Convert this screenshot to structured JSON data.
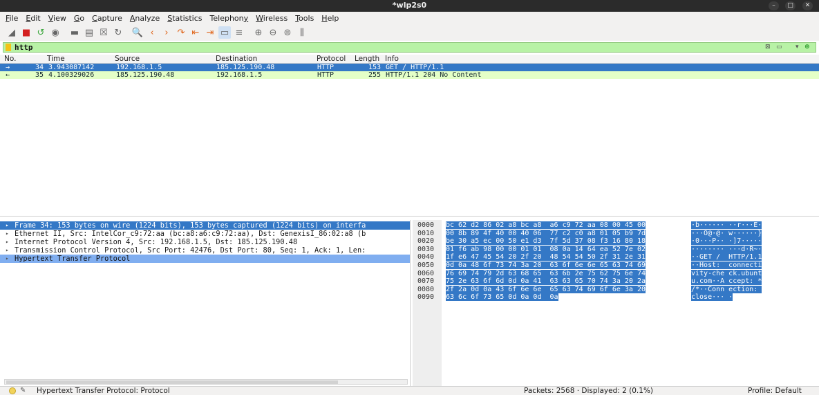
{
  "window": {
    "title": "*wlp2s0",
    "controls": [
      "–",
      "□",
      "✕"
    ]
  },
  "menubar": [
    {
      "key": "F",
      "rest": "ile"
    },
    {
      "key": "E",
      "rest": "dit"
    },
    {
      "key": "V",
      "rest": "iew"
    },
    {
      "key": "G",
      "rest": "o"
    },
    {
      "key": "C",
      "rest": "apture"
    },
    {
      "key": "A",
      "rest": "nalyze"
    },
    {
      "key": "S",
      "rest": "tatistics"
    },
    {
      "pre": "Telephon",
      "key": "y",
      "rest": ""
    },
    {
      "key": "W",
      "rest": "ireless"
    },
    {
      "key": "T",
      "rest": "ools"
    },
    {
      "key": "H",
      "rest": "elp"
    }
  ],
  "toolbar": {
    "icons": [
      "shark-fin-icon",
      "stop-icon",
      "restart-icon",
      "options-icon",
      "open-icon",
      "save-icon",
      "close-file-icon",
      "reload-icon",
      "find-icon",
      "go-back-icon",
      "go-forward-icon",
      "go-to-packet-icon",
      "first-packet-icon",
      "last-packet-icon",
      "autoscroll-icon",
      "colorize-icon",
      "zoom-in-icon",
      "zoom-out-icon",
      "normal-size-icon",
      "resize-columns-icon"
    ],
    "glyphs": [
      "◢",
      "■",
      "↺",
      "◉",
      "▬",
      "▤",
      "☒",
      "↻",
      "🔍",
      "‹",
      "›",
      "↷",
      "⇤",
      "⇥",
      "▭",
      "≡",
      "⊕",
      "⊖",
      "⊜",
      "⫼"
    ]
  },
  "filter": {
    "value": "http",
    "controls": [
      "⊠",
      "▭",
      "▾",
      "⊕"
    ]
  },
  "packet_list": {
    "columns": [
      "No.",
      "Time",
      "Source",
      "Destination",
      "Protocol",
      "Length",
      "Info"
    ],
    "rows": [
      {
        "no": "34",
        "time": "3.943087142",
        "source": "192.168.1.5",
        "destination": "185.125.190.48",
        "protocol": "HTTP",
        "length": "153",
        "info": "GET / HTTP/1.1",
        "marker": "→"
      },
      {
        "no": "35",
        "time": "4.100329026",
        "source": "185.125.190.48",
        "destination": "192.168.1.5",
        "protocol": "HTTP",
        "length": "255",
        "info": "HTTP/1.1 204 No Content",
        "marker": "←"
      }
    ]
  },
  "details": [
    "Frame 34: 153 bytes on wire (1224 bits), 153 bytes captured (1224 bits) on interfa",
    "Ethernet II, Src: IntelCor_c9:72:aa (bc:a8:a6:c9:72:aa), Dst: GenexisI_86:02:a8 (b",
    "Internet Protocol Version 4, Src: 192.168.1.5, Dst: 185.125.190.48",
    "Transmission Control Protocol, Src Port: 42476, Dst Port: 80, Seq: 1, Ack: 1, Len:",
    "Hypertext Transfer Protocol"
  ],
  "bytes": [
    {
      "off": "0000",
      "hex": "bc 62 d2 86 02 a8 bc a8  a6 c9 72 aa 08 00 45 00",
      "ascii": "·b······ ··r···E·"
    },
    {
      "off": "0010",
      "hex": "00 8b 89 4f 40 00 40 06  77 c2 c0 a8 01 05 b9 7d",
      "ascii": "···O@·@· w······}"
    },
    {
      "off": "0020",
      "hex": "be 30 a5 ec 00 50 e1 d3  7f 5d 37 08 f3 16 80 18",
      "ascii": "·0···P·· ·]7·····"
    },
    {
      "off": "0030",
      "hex": "01 f6 ab 98 00 00 01 01  08 0a 14 64 ea 52 7e 02",
      "ascii": "········ ···d·R~·"
    },
    {
      "off": "0040",
      "hex": "1f e6 47 45 54 20 2f 20  48 54 54 50 2f 31 2e 31",
      "ascii": "··GET /  HTTP/1.1"
    },
    {
      "off": "0050",
      "hex": "0d 0a 48 6f 73 74 3a 20  63 6f 6e 6e 65 63 74 69",
      "ascii": "··Host:  connecti"
    },
    {
      "off": "0060",
      "hex": "76 69 74 79 2d 63 68 65  63 6b 2e 75 62 75 6e 74",
      "ascii": "vity-che ck.ubunt"
    },
    {
      "off": "0070",
      "hex": "75 2e 63 6f 6d 0d 0a 41  63 63 65 70 74 3a 20 2a",
      "ascii": "u.com··A ccept: *"
    },
    {
      "off": "0080",
      "hex": "2f 2a 0d 0a 43 6f 6e 6e  65 63 74 69 6f 6e 3a 20",
      "ascii": "/*··Conn ection: "
    },
    {
      "off": "0090",
      "hex": "63 6c 6f 73 65 0d 0a 0d  0a",
      "ascii": "close··· ·"
    }
  ],
  "status": {
    "message": "Hypertext Transfer Protocol: Protocol",
    "packets": "Packets: 2568 · Displayed: 2 (0.1%)",
    "profile": "Profile: Default"
  },
  "colors": {
    "selected": "#3478c6",
    "filter_ok": "#b8f2a6",
    "http_row": "#e4ffc7"
  }
}
